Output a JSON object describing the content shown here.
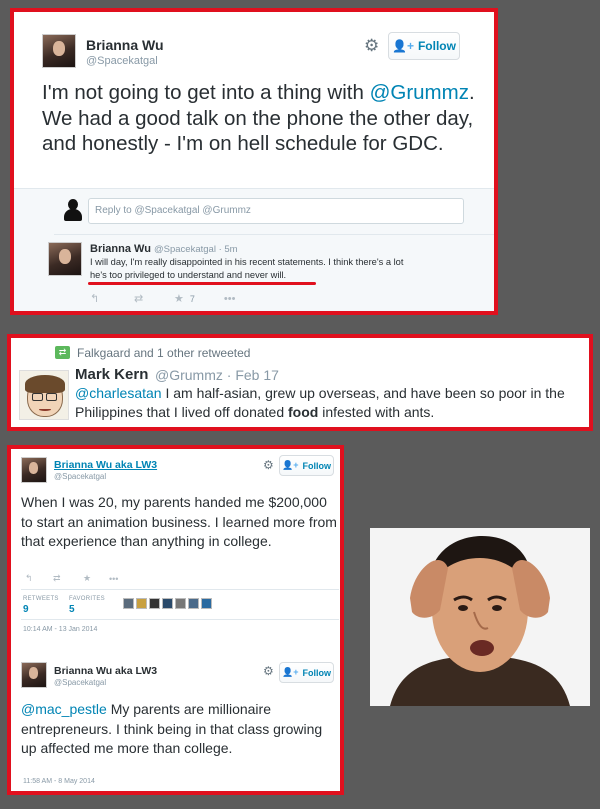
{
  "panel1": {
    "name": "Brianna Wu",
    "handle": "@Spacekatgal",
    "follow_label": "Follow",
    "text_pre": "I'm not going to get into a thing with ",
    "mention": "@Grummz",
    "text_post": ". We had a good talk on the phone the other day, and honestly - I'm on hell schedule for GDC.",
    "reply_placeholder": "Reply to @Spacekatgal @Grummz",
    "reply": {
      "name": "Brianna Wu",
      "handle": "@Spacekatgal",
      "sep": "·",
      "time": "5m",
      "text_a": "I will day, I'm really disappointed in his recent statements. I think there's a lot",
      "text_b": "he's too privileged to understand and never will.",
      "fav_count": "7"
    },
    "underline_color": "#e0101e"
  },
  "panel2": {
    "retweeted_by": "Falkgaard and 1 other retweeted",
    "name": "Mark Kern",
    "handle": "@Grummz",
    "sep": "·",
    "date": "Feb 17",
    "mention": "@charlesatan",
    "text_a": " I am half-asian, grew up overseas, and have been so poor in the Philippines that I lived off donated ",
    "text_bold": "food",
    "text_b": " infested with ants."
  },
  "panel3": {
    "tweet1": {
      "name": "Brianna Wu aka LW3",
      "handle": "@Spacekatgal",
      "follow_label": "Follow",
      "text": "When I was 20, my parents handed me $200,000 to start an animation business. I learned more from that experience than anything in college.",
      "retweets_label": "RETWEETS",
      "retweets": "9",
      "favorites_label": "FAVORITES",
      "favorites": "5",
      "timestamp": "10:14 AM - 13 Jan 2014"
    },
    "tweet2": {
      "name": "Brianna Wu aka LW3",
      "handle": "@Spacekatgal",
      "follow_label": "Follow",
      "mention": "@mac_pestle",
      "text": " My parents are millionaire entrepreneurs. I think being in that class growing up affected me more than college.",
      "timestamp": "11:58 AM - 8 May 2014"
    }
  },
  "colors": {
    "frame": "#e0101e",
    "link": "#0084b4",
    "background": "#5b5b5b"
  },
  "icons": [
    "gear-icon",
    "follow-person-icon",
    "reply-icon",
    "retweet-icon",
    "favorite-star-icon",
    "more-icon",
    "retweet-badge-icon"
  ]
}
